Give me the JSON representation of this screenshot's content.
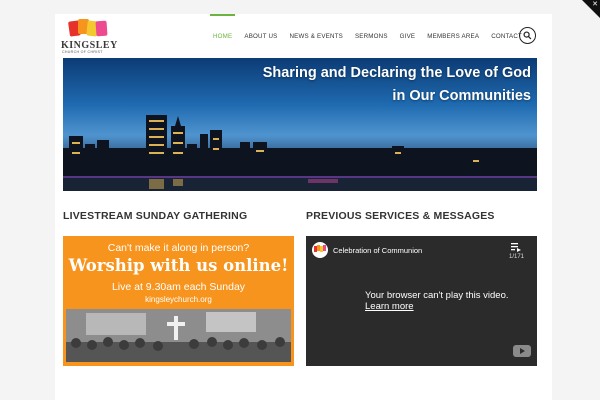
{
  "logo": {
    "name": "KINGSLEY",
    "subtitle": "CHURCH OF CHRIST"
  },
  "nav": {
    "items": [
      {
        "label": "HOME",
        "active": true
      },
      {
        "label": "ABOUT US",
        "active": false
      },
      {
        "label": "NEWS & EVENTS",
        "active": false
      },
      {
        "label": "SERMONS",
        "active": false
      },
      {
        "label": "GIVE",
        "active": false
      },
      {
        "label": "MEMBERS AREA",
        "active": false
      },
      {
        "label": "CONTACT",
        "active": false
      }
    ],
    "search_icon": "search-icon"
  },
  "hero": {
    "line1": "Sharing and Declaring the Love of God",
    "line2": "in Our Communities"
  },
  "sections": {
    "livestream_title": "LIVESTREAM SUNDAY GATHERING",
    "previous_title": "PREVIOUS SERVICES & MESSAGES"
  },
  "promo": {
    "line1": "Can't make it along in person?",
    "line2": "Worship with us online!",
    "line3": "Live at 9.30am each Sunday",
    "line4": "kingsleychurch.org"
  },
  "video": {
    "title": "Celebration of Communion",
    "playlist_count": "1/171",
    "message": "Your browser can't play this video.",
    "link": "Learn more"
  },
  "colors": {
    "accent": "#6cb33f",
    "promo": "#f7941d",
    "video_bg": "#2b2b2b"
  }
}
